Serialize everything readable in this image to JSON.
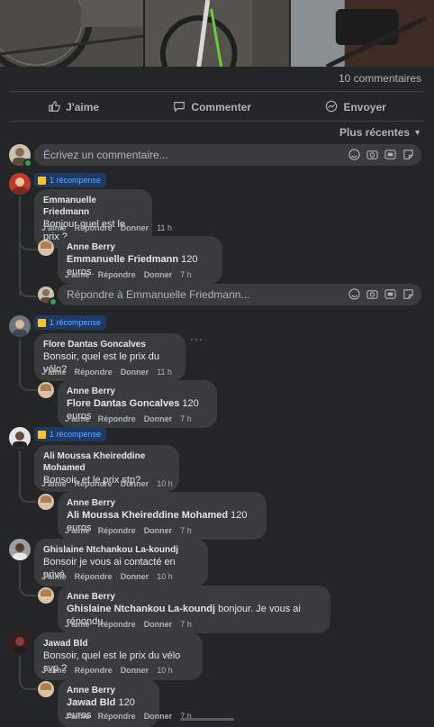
{
  "header": {
    "comment_count": "10 commentaires",
    "actions": {
      "like": "J'aime",
      "comment": "Commenter",
      "send": "Envoyer"
    },
    "sort_label": "Plus récentes"
  },
  "composer": {
    "placeholder": "Écrivez un commentaire..."
  },
  "badge_label": "1 récompense",
  "labels": {
    "like": "J'aime",
    "reply": "Répondre",
    "give": "Donner"
  },
  "comments": [
    {
      "author": "Emmanuelle Friedmann",
      "text": "Bonjour quel est le prix ?",
      "time": "11 h",
      "reply": {
        "author": "Anne Berry",
        "mention": "Emmanuelle Friedmann",
        "text": " 120 euros.",
        "time": "7 h"
      },
      "reply_placeholder": "Répondre à Emmanuelle Friedmann..."
    },
    {
      "author": "Flore Dantas Goncalves",
      "text": "Bonsoir, quel est le prix du vélo?",
      "time": "11 h",
      "more": "···",
      "reply": {
        "author": "Anne Berry",
        "mention": "Flore Dantas Goncalves",
        "text": " 120 euros",
        "time": "7 h"
      }
    },
    {
      "author": "Ali Moussa Kheireddine Mohamed",
      "text": "Bonsoir, et le prix stp?",
      "time": "10 h",
      "reply": {
        "author": "Anne Berry",
        "mention": "Ali Moussa Kheireddine Mohamed",
        "text": " 120 euros",
        "time": "7 h"
      }
    },
    {
      "author": "Ghislaine Ntchankou La-koundj",
      "text": "Bonsoir je vous ai contacté en privé",
      "time": "10 h",
      "reply": {
        "author": "Anne Berry",
        "mention": "Ghislaine Ntchankou La-koundj",
        "text": " bonjour. Je vous ai répondu.",
        "time": "7 h"
      }
    },
    {
      "author": "Jawad Bld",
      "text": "Bonsoir, quel est le prix du vélo svp ?",
      "time": "10 h",
      "reply": {
        "author": "Anne Berry",
        "mention": "Jawad Bld",
        "text": " 120 euros",
        "time": "7 h"
      }
    }
  ]
}
